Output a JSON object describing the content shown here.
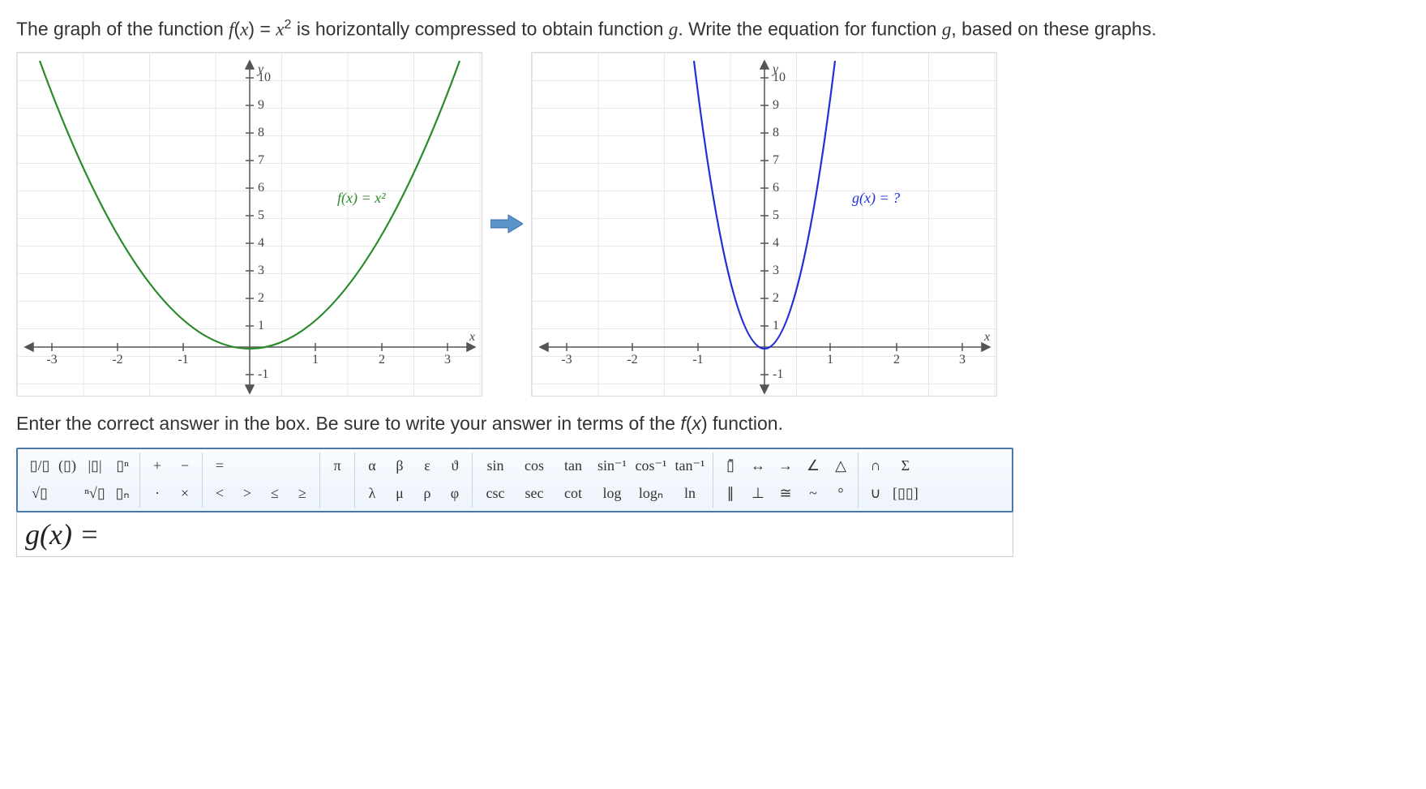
{
  "question_html": "The graph of the function <em>f</em>(<em>x</em>) = <em>x</em><sup>2</sup> is horizontally compressed to obtain function <em>g</em>. Write the equation for function <em>g</em>, based on these graphs.",
  "instruction_html": "Enter the correct answer in the box. Be sure to write your answer in terms of the <em>f</em>(<em>x</em>) function.",
  "answer_prompt_html": "<em>g</em>(<em>x</em>) = ",
  "graph_left": {
    "y_label": "y",
    "x_label": "x",
    "function_label": "f(x) = x²",
    "color": "#2a8a2a"
  },
  "graph_right": {
    "y_label": "y",
    "x_label": "x",
    "function_label": "g(x) = ?",
    "color": "#2030d8"
  },
  "chart_data": [
    {
      "type": "line",
      "title": "f(x) = x²",
      "xlabel": "x",
      "ylabel": "y",
      "xlim": [
        -3.5,
        3.5
      ],
      "ylim": [
        -1.5,
        10.5
      ],
      "xticks": [
        -3,
        -2,
        -1,
        1,
        2,
        3
      ],
      "yticks": [
        -1,
        1,
        2,
        3,
        4,
        5,
        6,
        7,
        8,
        9,
        10
      ],
      "series": [
        {
          "name": "f(x)",
          "expression": "x^2",
          "sample_points": {
            "x": [
              -3,
              -2,
              -1,
              0,
              1,
              2,
              3
            ],
            "y": [
              9,
              4,
              1,
              0,
              1,
              4,
              9
            ]
          }
        }
      ]
    },
    {
      "type": "line",
      "title": "g(x) = ?",
      "xlabel": "x",
      "ylabel": "y",
      "xlim": [
        -3.5,
        3.5
      ],
      "ylim": [
        -1.5,
        10.5
      ],
      "xticks": [
        -3,
        -2,
        -1,
        1,
        2,
        3
      ],
      "yticks": [
        -1,
        1,
        2,
        3,
        4,
        5,
        6,
        7,
        8,
        9,
        10
      ],
      "series": [
        {
          "name": "g(x)",
          "expression": "horizontally compressed x^2",
          "sample_points": {
            "x": [
              -1,
              -0.5,
              0,
              0.5,
              1
            ],
            "y": [
              9,
              2.25,
              0,
              2.25,
              9
            ]
          }
        }
      ]
    }
  ],
  "toolbar": {
    "g1": {
      "frac": "▯/▯",
      "paren": "(▯)",
      "abs": "|▯|",
      "sup": "▯ⁿ",
      "sqrt": "√▯",
      "nroot": "ⁿ√▯",
      "sub": "▯ₙ"
    },
    "g2": {
      "plus": "+",
      "minus": "−",
      "dot": "·",
      "times": "×"
    },
    "g3": {
      "eq": "=",
      "lt": "<",
      "gt": ">",
      "le": "≤",
      "ge": "≥"
    },
    "g4": {
      "pi": "π"
    },
    "g5": {
      "alpha": "α",
      "beta": "β",
      "eps": "ε",
      "theta": "ϑ",
      "lambda": "λ",
      "mu": "μ",
      "rho": "ρ",
      "phi": "φ"
    },
    "g6": {
      "sin": "sin",
      "cos": "cos",
      "tan": "tan",
      "asin": "sin⁻¹",
      "acos": "cos⁻¹",
      "atan": "tan⁻¹",
      "csc": "csc",
      "sec": "sec",
      "cot": "cot",
      "log": "log",
      "logn": "logₙ",
      "ln": "ln"
    },
    "g7": {
      "bar": "▯̄",
      "darrow": "↔",
      "rarrow": "→",
      "angle": "∠",
      "tri": "△",
      "par": "∥",
      "perp": "⊥",
      "cong": "≅",
      "sim": "~",
      "deg": "°"
    },
    "g8": {
      "cap": "∩",
      "cup": "∪",
      "sum": "Σ",
      "matrix": "[▯▯]"
    }
  }
}
